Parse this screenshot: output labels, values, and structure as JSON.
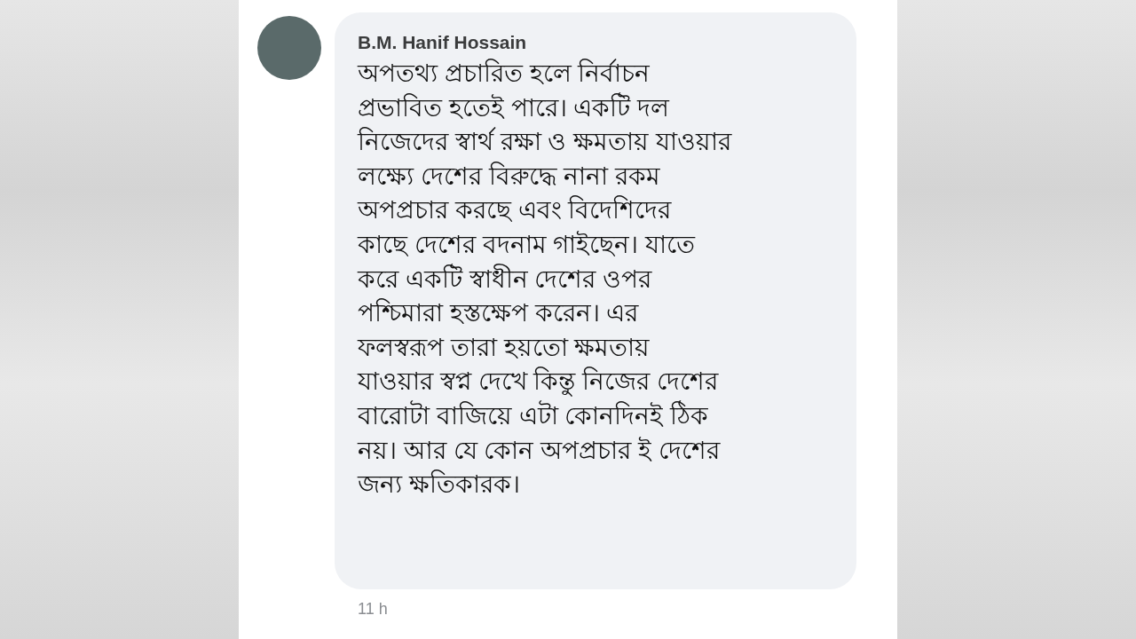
{
  "comment": {
    "author": "B.M. Hanif Hossain",
    "text": "অপতথ্য প্রচারিত হলে নির্বাচন\nপ্রভাবিত হতেই পারে। একটি দল\nনিজেদের স্বার্থ রক্ষা ও ক্ষমতায় যাওয়ার\nলক্ষ্যে দেশের বিরুদ্ধে নানা রকম\nঅপপ্রচার করছে এবং বিদেশিদের\nকাছে দেশের বদনাম গাইছেন। যাতে\nকরে একটি স্বাধীন দেশের ওপর\nপশ্চিমারা হস্তক্ষেপ করেন। এর\nফলস্বরূপ তারা হয়তো ক্ষমতায়\nযাওয়ার স্বপ্ন দেখে কিন্তু নিজের দেশের\nবারোটা বাজিয়ে এটা কোনদিনই ঠিক\nনয়। আর যে কোন অপপ্রচার ই দেশের\nজন্য ক্ষতিকারক।",
    "time": "11 h"
  }
}
